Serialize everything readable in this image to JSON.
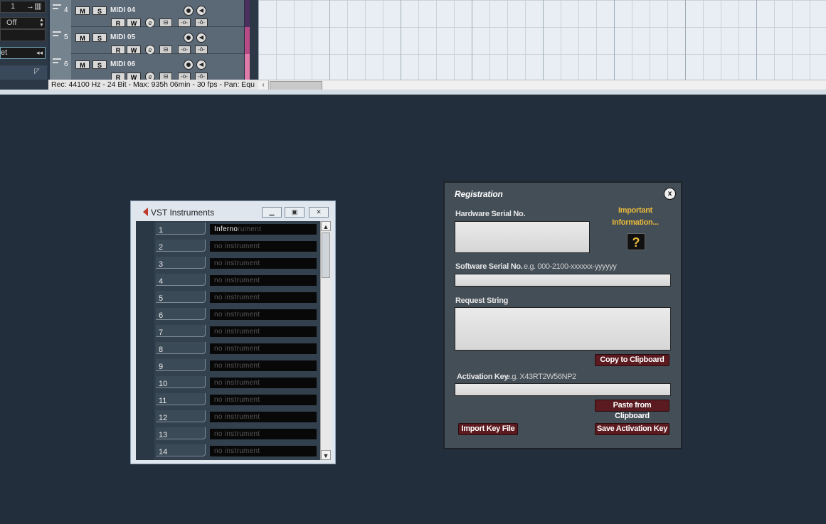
{
  "daw": {
    "inspector": {
      "field_top": "1",
      "field_off": "Off",
      "field_preset": "et"
    },
    "tracks": [
      {
        "number": "4",
        "name": "MIDI 04"
      },
      {
        "number": "5",
        "name": "MIDI 05"
      },
      {
        "number": "6",
        "name": "MIDI 06"
      }
    ],
    "track_buttons": {
      "mute": "M",
      "solo": "S",
      "read": "R",
      "write": "W",
      "edit": "e"
    },
    "status_text": "Rec: 44100 Hz - 24 Bit - Max: 935h 06min - 30 fps - Pan: Equ",
    "track_colors": [
      "#5a3a6e",
      "#b84a86",
      "#e07aa8"
    ]
  },
  "vst_window": {
    "title": "VST Instruments",
    "slots": [
      {
        "number": "1",
        "instrument": "Inferno",
        "placeholder_tail": "rument"
      },
      {
        "number": "2",
        "instrument": "",
        "placeholder": "no instrument"
      },
      {
        "number": "3",
        "instrument": "",
        "placeholder": "no instrument"
      },
      {
        "number": "4",
        "instrument": "",
        "placeholder": "no instrument"
      },
      {
        "number": "5",
        "instrument": "",
        "placeholder": "no instrument"
      },
      {
        "number": "6",
        "instrument": "",
        "placeholder": "no instrument"
      },
      {
        "number": "7",
        "instrument": "",
        "placeholder": "no instrument"
      },
      {
        "number": "8",
        "instrument": "",
        "placeholder": "no instrument"
      },
      {
        "number": "9",
        "instrument": "",
        "placeholder": "no instrument"
      },
      {
        "number": "10",
        "instrument": "",
        "placeholder": "no instrument"
      },
      {
        "number": "11",
        "instrument": "",
        "placeholder": "no instrument"
      },
      {
        "number": "12",
        "instrument": "",
        "placeholder": "no instrument"
      },
      {
        "number": "13",
        "instrument": "",
        "placeholder": "no instrument"
      },
      {
        "number": "14",
        "instrument": "",
        "placeholder": "no instrument"
      }
    ]
  },
  "registration": {
    "title": "Registration",
    "hardware_serial_label": "Hardware Serial No.",
    "important_info_line1": "Important",
    "important_info_line2": "Information...",
    "help_glyph": "?",
    "software_serial_label": "Software Serial No.",
    "software_serial_hint": "e.g. 000-2100-xxxxxx-yyyyyy",
    "request_string_label": "Request String",
    "copy_button": "Copy to Clipboard",
    "activation_key_label": "Activation Key",
    "activation_key_hint": "e.g. X43RT2W56NP2",
    "paste_button": "Paste from Clipboard",
    "import_button": "Import Key File",
    "save_button": "Save Activation Key",
    "close_glyph": "x",
    "colors": {
      "button": "#5b1a1f",
      "accent": "#e8b93c",
      "panel": "#444e57"
    }
  }
}
